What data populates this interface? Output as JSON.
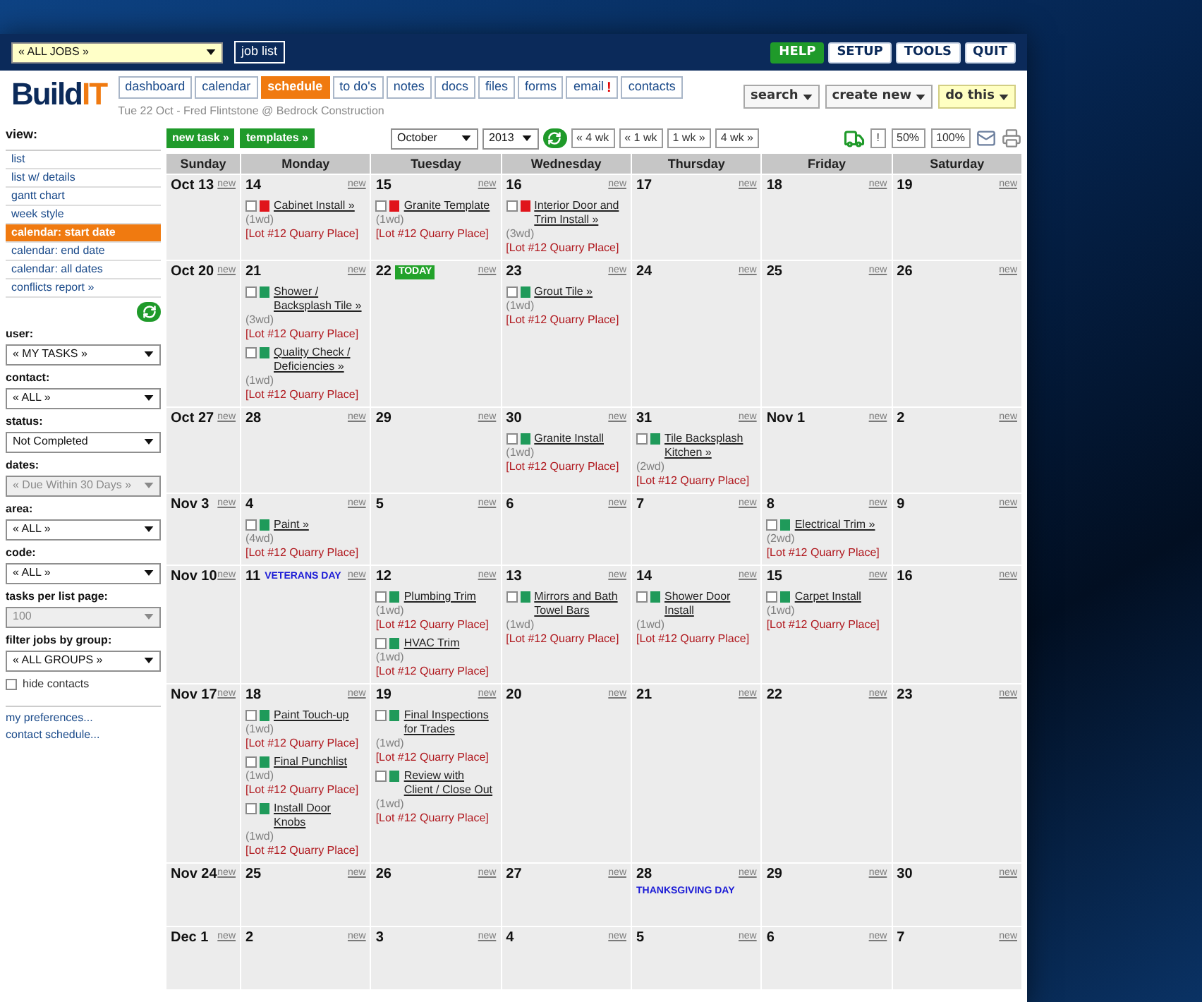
{
  "header": {
    "job_select": "« ALL JOBS »",
    "job_list_button": "job list",
    "buttons": [
      {
        "label": "HELP",
        "kind": "accent"
      },
      {
        "label": "SETUP",
        "kind": "plain"
      },
      {
        "label": "TOOLS",
        "kind": "plain"
      },
      {
        "label": "QUIT",
        "kind": "plain"
      }
    ]
  },
  "logo": {
    "text": "Build",
    "accent": "IT"
  },
  "tabs": [
    {
      "label": "dashboard",
      "selected": false
    },
    {
      "label": "calendar",
      "selected": false
    },
    {
      "label": "schedule",
      "selected": true
    },
    {
      "label": "to do's",
      "selected": false
    },
    {
      "label": "notes",
      "selected": false
    },
    {
      "label": "docs",
      "selected": false
    },
    {
      "label": "files",
      "selected": false
    },
    {
      "label": "forms",
      "selected": false
    },
    {
      "label": "email",
      "selected": false,
      "badge": "!"
    },
    {
      "label": "contacts",
      "selected": false
    }
  ],
  "context": "Tue 22 Oct - Fred Flintstone @ Bedrock Construction",
  "menus": [
    {
      "label": "search",
      "kind": "plain"
    },
    {
      "label": "create new",
      "kind": "plain"
    },
    {
      "label": "do this",
      "kind": "accent"
    }
  ],
  "actions": [
    "new task »",
    "templates »"
  ],
  "date_nav": {
    "month": "October",
    "year": "2013",
    "steps": [
      "« 4 wk",
      "« 1 wk",
      "1 wk »",
      "4 wk »"
    ]
  },
  "view_buttons": [
    "!",
    "50%",
    "100%"
  ],
  "sidebar": {
    "view_label": "view:",
    "views": [
      {
        "label": "list",
        "selected": false
      },
      {
        "label": "list w/ details",
        "selected": false
      },
      {
        "label": "gantt chart",
        "selected": false
      },
      {
        "label": "week style",
        "selected": false
      },
      {
        "label": "calendar: start date",
        "selected": true
      },
      {
        "label": "calendar: end date",
        "selected": false
      },
      {
        "label": "calendar: all dates",
        "selected": false
      },
      {
        "label": "conflicts report »",
        "selected": false
      }
    ],
    "filters": [
      {
        "label": "user:",
        "value": "« MY TASKS »",
        "disabled": false
      },
      {
        "label": "contact:",
        "value": "« ALL »",
        "disabled": false
      },
      {
        "label": "status:",
        "value": "Not Completed",
        "disabled": false
      },
      {
        "label": "dates:",
        "value": "« Due Within 30 Days »",
        "disabled": true
      },
      {
        "label": "area:",
        "value": "« ALL »",
        "disabled": false
      },
      {
        "label": "code:",
        "value": "« ALL »",
        "disabled": false
      },
      {
        "label": "tasks per list page:",
        "value": "100",
        "disabled": true
      },
      {
        "label": "filter jobs by group:",
        "value": "« ALL GROUPS »",
        "disabled": false
      }
    ],
    "hide_contacts": {
      "label": "hide contacts",
      "checked": false
    },
    "links": [
      "my preferences...",
      "contact schedule..."
    ]
  },
  "calendar": {
    "columns": [
      "Sunday",
      "Monday",
      "Tuesday",
      "Wednesday",
      "Thursday",
      "Friday",
      "Saturday"
    ],
    "weeks": [
      {
        "days": [
          {
            "date": "Oct 13",
            "new_link": "new"
          },
          {
            "date": "14",
            "new_link": "new",
            "tasks": [
              {
                "title": "Cabinet Install »",
                "duration": "(1wd)",
                "location": "[Lot #12 Quarry Place]",
                "color": "#e0141b",
                "checked": false
              }
            ]
          },
          {
            "date": "15",
            "new_link": "new",
            "tasks": [
              {
                "title": "Granite Template",
                "duration": "(1wd)",
                "location": "[Lot #12 Quarry Place]",
                "color": "#e0141b",
                "checked": false
              }
            ]
          },
          {
            "date": "16",
            "new_link": "new",
            "tasks": [
              {
                "title": "Interior Door and Trim Install »",
                "duration": "(3wd)",
                "location": "[Lot #12 Quarry Place]",
                "color": "#e0141b",
                "checked": false
              }
            ]
          },
          {
            "date": "17",
            "new_link": "new"
          },
          {
            "date": "18",
            "new_link": "new"
          },
          {
            "date": "19",
            "new_link": "new"
          }
        ]
      },
      {
        "days": [
          {
            "date": "Oct 20",
            "new_link": "new"
          },
          {
            "date": "21",
            "new_link": "new",
            "tasks": [
              {
                "title": "Shower / Backsplash Tile »",
                "duration": "(3wd)",
                "location": "[Lot #12 Quarry Place]",
                "color": "#1f9a5a",
                "checked": false
              },
              {
                "title": "Quality Check / Deficiencies »",
                "duration": "(1wd)",
                "location": "[Lot #12 Quarry Place]",
                "color": "#1f9a5a",
                "checked": false
              }
            ]
          },
          {
            "date": "22",
            "new_link": "new",
            "badge": "TODAY"
          },
          {
            "date": "23",
            "new_link": "new",
            "tasks": [
              {
                "title": "Grout Tile »",
                "duration": "(1wd)",
                "location": "[Lot #12 Quarry Place]",
                "color": "#1f9a5a",
                "checked": false
              }
            ]
          },
          {
            "date": "24",
            "new_link": "new"
          },
          {
            "date": "25",
            "new_link": "new"
          },
          {
            "date": "26",
            "new_link": "new"
          }
        ]
      },
      {
        "days": [
          {
            "date": "Oct 27",
            "new_link": "new"
          },
          {
            "date": "28",
            "new_link": "new"
          },
          {
            "date": "29",
            "new_link": "new"
          },
          {
            "date": "30",
            "new_link": "new",
            "tasks": [
              {
                "title": "Granite Install",
                "duration": "(1wd)",
                "location": "[Lot #12 Quarry Place]",
                "color": "#1f9a5a",
                "checked": false
              }
            ]
          },
          {
            "date": "31",
            "new_link": "new",
            "tasks": [
              {
                "title": "Tile Backsplash Kitchen »",
                "duration": "(2wd)",
                "location": "[Lot #12 Quarry Place]",
                "color": "#1f9a5a",
                "checked": false
              }
            ]
          },
          {
            "date": "Nov 1",
            "new_link": "new"
          },
          {
            "date": "2",
            "new_link": "new"
          }
        ]
      },
      {
        "days": [
          {
            "date": "Nov 3",
            "new_link": "new"
          },
          {
            "date": "4",
            "new_link": "new",
            "tasks": [
              {
                "title": "Paint »",
                "duration": "(4wd)",
                "location": "[Lot #12 Quarry Place]",
                "color": "#1f9a5a",
                "checked": false
              }
            ]
          },
          {
            "date": "5",
            "new_link": "new"
          },
          {
            "date": "6",
            "new_link": "new"
          },
          {
            "date": "7",
            "new_link": "new"
          },
          {
            "date": "8",
            "new_link": "new",
            "tasks": [
              {
                "title": "Electrical Trim »",
                "duration": "(2wd)",
                "location": "[Lot #12 Quarry Place]",
                "color": "#1f9a5a",
                "checked": false
              }
            ]
          },
          {
            "date": "9",
            "new_link": "new"
          }
        ]
      },
      {
        "days": [
          {
            "date": "Nov 10",
            "new_link": "new"
          },
          {
            "date": "11",
            "new_link": "new",
            "holiday": "VETERANS DAY"
          },
          {
            "date": "12",
            "new_link": "new",
            "tasks": [
              {
                "title": "Plumbing Trim",
                "duration": "(1wd)",
                "location": "[Lot #12 Quarry Place]",
                "color": "#1f9a5a",
                "checked": false
              },
              {
                "title": "HVAC Trim",
                "duration": "(1wd)",
                "location": "[Lot #12 Quarry Place]",
                "color": "#1f9a5a",
                "checked": false
              }
            ]
          },
          {
            "date": "13",
            "new_link": "new",
            "tasks": [
              {
                "title": "Mirrors and Bath Towel Bars",
                "duration": "(1wd)",
                "location": "[Lot #12 Quarry Place]",
                "color": "#1f9a5a",
                "checked": false
              }
            ]
          },
          {
            "date": "14",
            "new_link": "new",
            "tasks": [
              {
                "title": "Shower Door Install",
                "duration": "(1wd)",
                "location": "[Lot #12 Quarry Place]",
                "color": "#1f9a5a",
                "checked": false
              }
            ]
          },
          {
            "date": "15",
            "new_link": "new",
            "tasks": [
              {
                "title": "Carpet Install",
                "duration": "(1wd)",
                "location": "[Lot #12 Quarry Place]",
                "color": "#1f9a5a",
                "checked": false
              }
            ]
          },
          {
            "date": "16",
            "new_link": "new"
          }
        ]
      },
      {
        "days": [
          {
            "date": "Nov 17",
            "new_link": "new"
          },
          {
            "date": "18",
            "new_link": "new",
            "tasks": [
              {
                "title": "Paint Touch-up",
                "duration": "(1wd)",
                "location": "[Lot #12 Quarry Place]",
                "color": "#1f9a5a",
                "checked": false
              },
              {
                "title": "Final Punchlist",
                "duration": "(1wd)",
                "location": "[Lot #12 Quarry Place]",
                "color": "#1f9a5a",
                "checked": false
              },
              {
                "title": "Install Door Knobs",
                "duration": "(1wd)",
                "location": "[Lot #12 Quarry Place]",
                "color": "#1f9a5a",
                "checked": false
              }
            ]
          },
          {
            "date": "19",
            "new_link": "new",
            "tasks": [
              {
                "title": "Final Inspections for Trades",
                "duration": "(1wd)",
                "location": "[Lot #12 Quarry Place]",
                "color": "#1f9a5a",
                "checked": false
              },
              {
                "title": "Review with Client / Close Out",
                "duration": "(1wd)",
                "location": "[Lot #12 Quarry Place]",
                "color": "#1f9a5a",
                "checked": false
              }
            ]
          },
          {
            "date": "20",
            "new_link": "new"
          },
          {
            "date": "21",
            "new_link": "new"
          },
          {
            "date": "22",
            "new_link": "new"
          },
          {
            "date": "23",
            "new_link": "new"
          }
        ]
      },
      {
        "days": [
          {
            "date": "Nov 24",
            "new_link": "new"
          },
          {
            "date": "25",
            "new_link": "new"
          },
          {
            "date": "26",
            "new_link": "new"
          },
          {
            "date": "27",
            "new_link": "new"
          },
          {
            "date": "28",
            "new_link": "new",
            "holiday": "THANKSGIVING DAY"
          },
          {
            "date": "29",
            "new_link": "new"
          },
          {
            "date": "30",
            "new_link": "new"
          }
        ]
      },
      {
        "days": [
          {
            "date": "Dec 1",
            "new_link": "new"
          },
          {
            "date": "2",
            "new_link": "new"
          },
          {
            "date": "3",
            "new_link": "new"
          },
          {
            "date": "4",
            "new_link": "new"
          },
          {
            "date": "5",
            "new_link": "new"
          },
          {
            "date": "6",
            "new_link": "new"
          },
          {
            "date": "7",
            "new_link": "new"
          }
        ]
      }
    ]
  }
}
